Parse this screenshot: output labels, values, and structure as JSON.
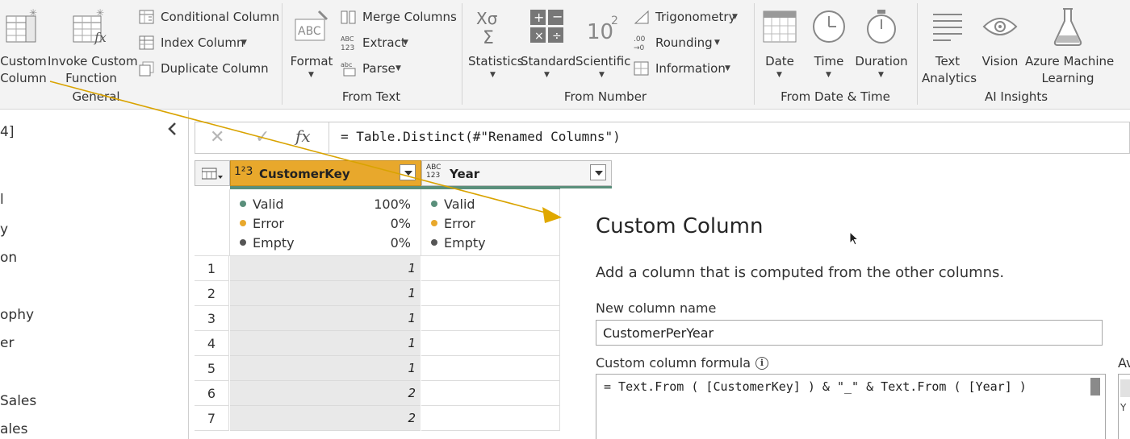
{
  "ribbon": {
    "general": {
      "custom_column": [
        "Custom",
        "Column"
      ],
      "invoke_custom_function": [
        "Invoke Custom",
        "Function"
      ],
      "conditional_column": "Conditional Column",
      "index_column": "Index Column",
      "duplicate_column": "Duplicate Column",
      "group_label": "General"
    },
    "from_text": {
      "format": "Format",
      "merge_columns": "Merge Columns",
      "extract": "Extract",
      "parse": "Parse",
      "group_label": "From Text"
    },
    "from_number": {
      "statistics": "Statistics",
      "standard": "Standard",
      "scientific": "Scientific",
      "trigonometry": "Trigonometry",
      "rounding": "Rounding",
      "information": "Information",
      "group_label": "From Number"
    },
    "from_date_time": {
      "date": "Date",
      "time": "Time",
      "duration": "Duration",
      "group_label": "From Date & Time"
    },
    "ai_insights": {
      "text_analytics": [
        "Text",
        "Analytics"
      ],
      "vision": "Vision",
      "azure_ml": [
        "Azure Machine",
        "Learning"
      ],
      "group_label": "AI Insights"
    }
  },
  "left_pane": {
    "items": [
      "4]",
      "l",
      "y",
      "on",
      "ophy",
      "er",
      "Sales",
      "ales"
    ]
  },
  "formula_bar": {
    "cancel": "✕",
    "commit": "✓",
    "fx": "fx",
    "formula": "= Table.Distinct(#\"Renamed Columns\")"
  },
  "grid": {
    "columns": [
      {
        "type_icon": "1²3",
        "name": "CustomerKey",
        "quality": {
          "valid": "Valid",
          "valid_pct": "100%",
          "error": "Error",
          "error_pct": "0%",
          "empty": "Empty",
          "empty_pct": "0%"
        }
      },
      {
        "type_icon": "ABC 123",
        "name": "Year",
        "quality": {
          "valid": "Valid",
          "error": "Error",
          "empty": "Empty"
        }
      }
    ],
    "rows": [
      {
        "num": "1",
        "customer_key": "1"
      },
      {
        "num": "2",
        "customer_key": "1"
      },
      {
        "num": "3",
        "customer_key": "1"
      },
      {
        "num": "4",
        "customer_key": "1"
      },
      {
        "num": "5",
        "customer_key": "1"
      },
      {
        "num": "6",
        "customer_key": "2"
      },
      {
        "num": "7",
        "customer_key": "2"
      }
    ]
  },
  "dialog": {
    "title": "Custom Column",
    "subtitle": "Add a column that is computed from the other columns.",
    "name_label": "New column name",
    "name_value": "CustomerPerYear",
    "formula_label": "Custom column formula",
    "info_icon": "i",
    "formula_value": "= Text.From ( [CustomerKey] ) & \"_\" & Text.From ( [Year] )",
    "available_label": "Av"
  },
  "colors": {
    "accent_yellow": "#e8a82c",
    "valid_green": "#5a8f7b",
    "error_orange": "#e8a82c",
    "empty_gray": "#555555",
    "ribbon_bg": "#f3f3f3",
    "annotation_arrow": "#d9a300"
  }
}
